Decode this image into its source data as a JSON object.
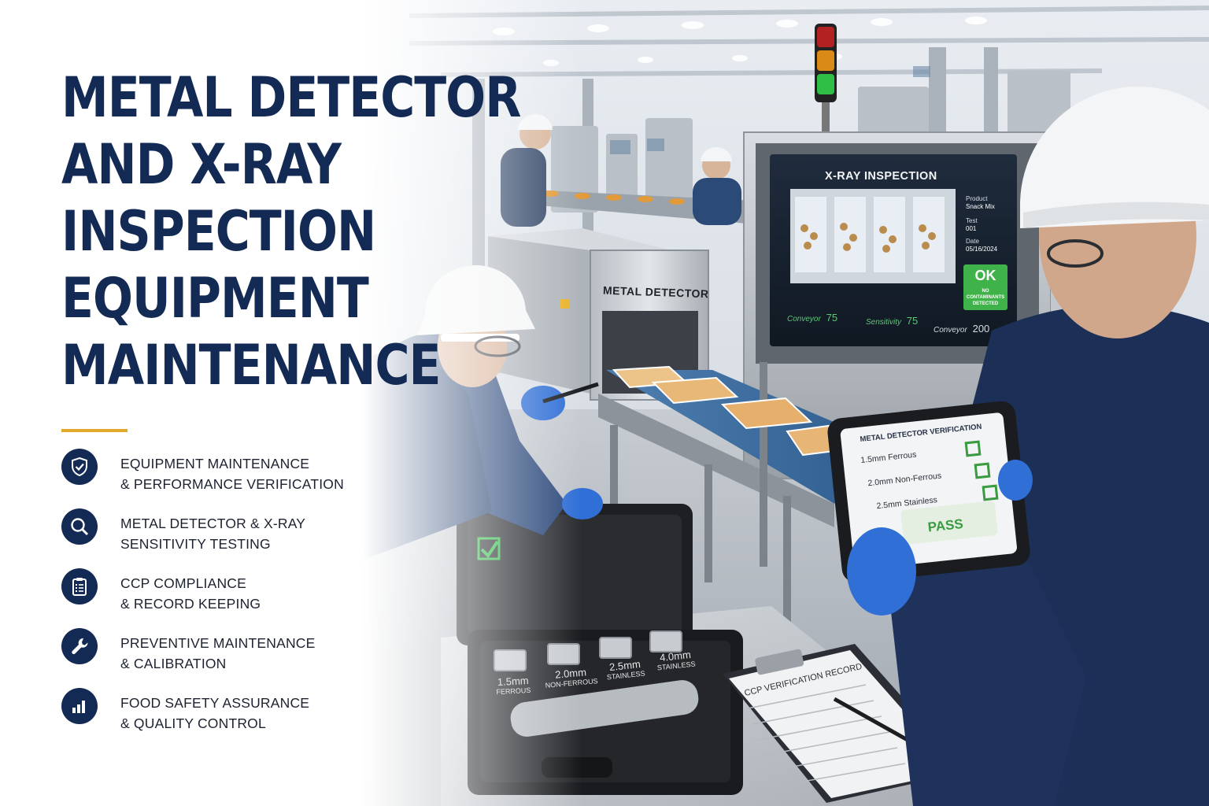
{
  "headline": {
    "lines": [
      "METAL DETECTOR",
      "AND X-RAY",
      "INSPECTION",
      "EQUIPMENT",
      "MAINTENANCE"
    ]
  },
  "features": [
    {
      "icon": "shield-check-icon",
      "line1": "EQUIPMENT MAINTENANCE",
      "line2": "& PERFORMANCE VERIFICATION"
    },
    {
      "icon": "magnifier-icon",
      "line1": "METAL DETECTOR & X-RAY",
      "line2": "SENSITIVITY TESTING"
    },
    {
      "icon": "clipboard-checklist-icon",
      "line1": "CCP COMPLIANCE",
      "line2": "& RECORD KEEPING"
    },
    {
      "icon": "wrench-icon",
      "line1": "PREVENTIVE MAINTENANCE",
      "line2": "& CALIBRATION"
    },
    {
      "icon": "bar-chart-icon",
      "line1": "FOOD SAFETY ASSURANCE",
      "line2": "& QUALITY CONTROL"
    }
  ],
  "scene": {
    "detector_label": "METAL DETECTOR",
    "xray_screen": {
      "title": "X-RAY INSPECTION",
      "product_label": "Product",
      "product_value": "Snack Mix",
      "test_label": "Test",
      "test_value": "001",
      "date_label": "Date",
      "date_value": "05/16/2024",
      "status": "OK",
      "status_detail": "NO CONTAMINANTS DETECTED",
      "readouts": [
        {
          "label": "Conveyor",
          "value": "75"
        },
        {
          "label": "Sensitivity",
          "value": "75"
        },
        {
          "label": "Conveyor",
          "value": "200"
        }
      ]
    },
    "tablet": {
      "title": "METAL DETECTOR VERIFICATION",
      "items": [
        "1.5mm Ferrous",
        "2.0mm Non-Ferrous",
        "2.5mm Stainless"
      ],
      "result": "PASS"
    },
    "test_kit": {
      "pieces": [
        {
          "size": "1.5mm",
          "type": "FERROUS"
        },
        {
          "size": "2.0mm",
          "type": "NON-FERROUS"
        },
        {
          "size": "2.5mm",
          "type": "STAINLESS"
        },
        {
          "size": "4.0mm",
          "type": "STAINLESS"
        }
      ]
    },
    "clipboard_title": "CCP VERIFICATION RECORD"
  },
  "colors": {
    "navy": "#122a54",
    "accent_gold": "#e2a82a",
    "ok_green": "#3fb24a",
    "glove_blue": "#2f6fd6",
    "hardhat_white": "#f4f5f6"
  }
}
